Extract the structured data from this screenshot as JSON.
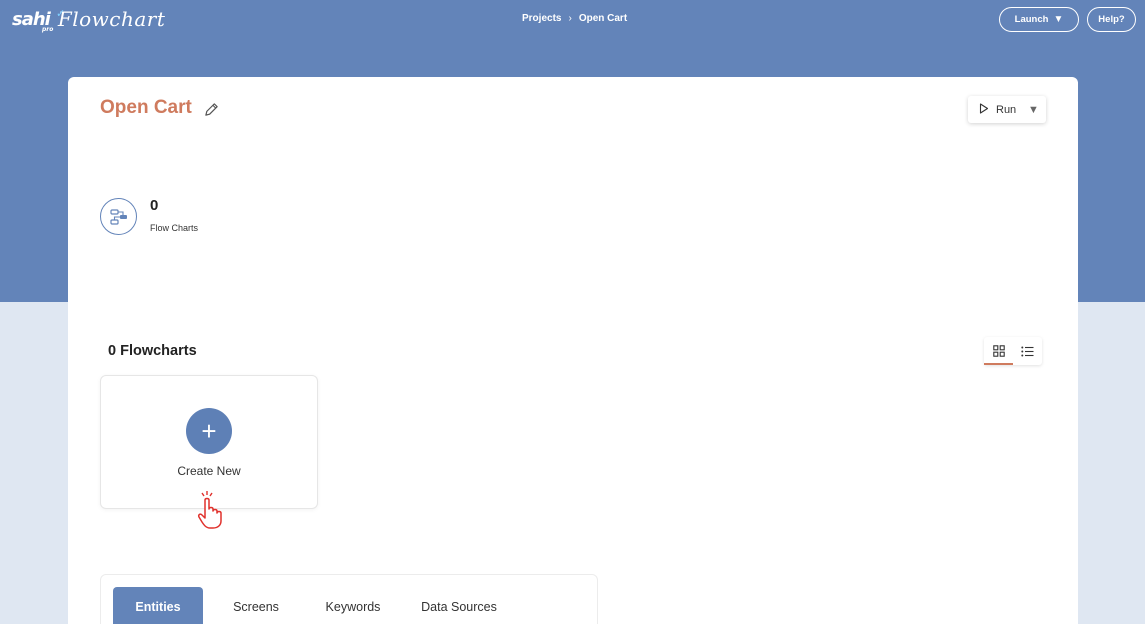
{
  "app": {
    "logo_mark": "sahi",
    "logo_sub": "pro",
    "logo_text": "Flowchart"
  },
  "breadcrumb": {
    "items": [
      "Projects",
      "Open Cart"
    ],
    "separator": "›"
  },
  "header": {
    "launch_label": "Launch",
    "help_label": "Help?"
  },
  "project": {
    "title": "Open Cart",
    "run_label": "Run"
  },
  "stats": {
    "flowchart_count": "0",
    "flowchart_label": "Flow Charts"
  },
  "flowcharts": {
    "heading": "0 Flowcharts",
    "create_label": "Create New",
    "create_symbol": "+"
  },
  "tabs": [
    {
      "label": "Entities",
      "active": true
    },
    {
      "label": "Screens",
      "active": false
    },
    {
      "label": "Keywords",
      "active": false
    },
    {
      "label": "Data Sources",
      "active": false
    }
  ],
  "colors": {
    "header_blue": "#6384b9",
    "title_accent": "#cf7b5e",
    "page_bg": "#dfe7f2",
    "cursor_red": "#e0312c"
  },
  "icons": {
    "edit": "pencil-icon",
    "run": "play-icon",
    "run_menu": "caret-down-icon",
    "flowchart_stat": "flowchart-icon",
    "grid_view": "grid-view-icon",
    "list_view": "list-view-icon",
    "cursor": "hand-pointer-icon"
  }
}
